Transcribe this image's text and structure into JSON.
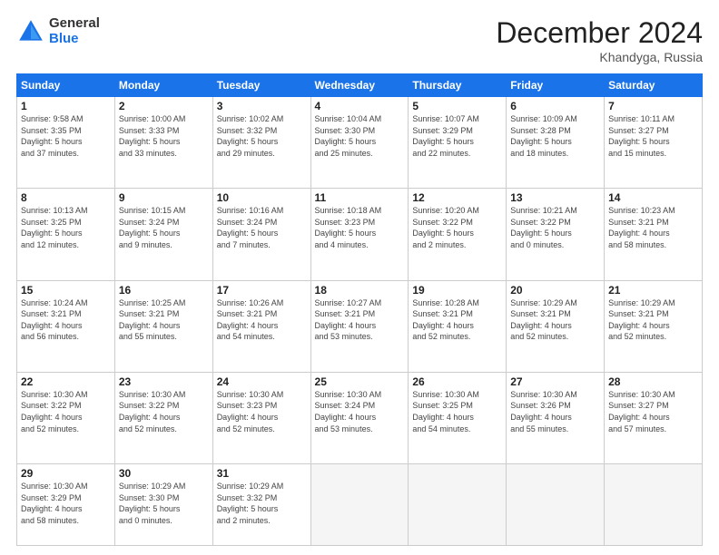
{
  "logo": {
    "general": "General",
    "blue": "Blue"
  },
  "header": {
    "month": "December 2024",
    "location": "Khandyga, Russia"
  },
  "weekdays": [
    "Sunday",
    "Monday",
    "Tuesday",
    "Wednesday",
    "Thursday",
    "Friday",
    "Saturday"
  ],
  "weeks": [
    [
      {
        "day": "1",
        "info": "Sunrise: 9:58 AM\nSunset: 3:35 PM\nDaylight: 5 hours\nand 37 minutes."
      },
      {
        "day": "2",
        "info": "Sunrise: 10:00 AM\nSunset: 3:33 PM\nDaylight: 5 hours\nand 33 minutes."
      },
      {
        "day": "3",
        "info": "Sunrise: 10:02 AM\nSunset: 3:32 PM\nDaylight: 5 hours\nand 29 minutes."
      },
      {
        "day": "4",
        "info": "Sunrise: 10:04 AM\nSunset: 3:30 PM\nDaylight: 5 hours\nand 25 minutes."
      },
      {
        "day": "5",
        "info": "Sunrise: 10:07 AM\nSunset: 3:29 PM\nDaylight: 5 hours\nand 22 minutes."
      },
      {
        "day": "6",
        "info": "Sunrise: 10:09 AM\nSunset: 3:28 PM\nDaylight: 5 hours\nand 18 minutes."
      },
      {
        "day": "7",
        "info": "Sunrise: 10:11 AM\nSunset: 3:27 PM\nDaylight: 5 hours\nand 15 minutes."
      }
    ],
    [
      {
        "day": "8",
        "info": "Sunrise: 10:13 AM\nSunset: 3:25 PM\nDaylight: 5 hours\nand 12 minutes."
      },
      {
        "day": "9",
        "info": "Sunrise: 10:15 AM\nSunset: 3:24 PM\nDaylight: 5 hours\nand 9 minutes."
      },
      {
        "day": "10",
        "info": "Sunrise: 10:16 AM\nSunset: 3:24 PM\nDaylight: 5 hours\nand 7 minutes."
      },
      {
        "day": "11",
        "info": "Sunrise: 10:18 AM\nSunset: 3:23 PM\nDaylight: 5 hours\nand 4 minutes."
      },
      {
        "day": "12",
        "info": "Sunrise: 10:20 AM\nSunset: 3:22 PM\nDaylight: 5 hours\nand 2 minutes."
      },
      {
        "day": "13",
        "info": "Sunrise: 10:21 AM\nSunset: 3:22 PM\nDaylight: 5 hours\nand 0 minutes."
      },
      {
        "day": "14",
        "info": "Sunrise: 10:23 AM\nSunset: 3:21 PM\nDaylight: 4 hours\nand 58 minutes."
      }
    ],
    [
      {
        "day": "15",
        "info": "Sunrise: 10:24 AM\nSunset: 3:21 PM\nDaylight: 4 hours\nand 56 minutes."
      },
      {
        "day": "16",
        "info": "Sunrise: 10:25 AM\nSunset: 3:21 PM\nDaylight: 4 hours\nand 55 minutes."
      },
      {
        "day": "17",
        "info": "Sunrise: 10:26 AM\nSunset: 3:21 PM\nDaylight: 4 hours\nand 54 minutes."
      },
      {
        "day": "18",
        "info": "Sunrise: 10:27 AM\nSunset: 3:21 PM\nDaylight: 4 hours\nand 53 minutes."
      },
      {
        "day": "19",
        "info": "Sunrise: 10:28 AM\nSunset: 3:21 PM\nDaylight: 4 hours\nand 52 minutes."
      },
      {
        "day": "20",
        "info": "Sunrise: 10:29 AM\nSunset: 3:21 PM\nDaylight: 4 hours\nand 52 minutes."
      },
      {
        "day": "21",
        "info": "Sunrise: 10:29 AM\nSunset: 3:21 PM\nDaylight: 4 hours\nand 52 minutes."
      }
    ],
    [
      {
        "day": "22",
        "info": "Sunrise: 10:30 AM\nSunset: 3:22 PM\nDaylight: 4 hours\nand 52 minutes."
      },
      {
        "day": "23",
        "info": "Sunrise: 10:30 AM\nSunset: 3:22 PM\nDaylight: 4 hours\nand 52 minutes."
      },
      {
        "day": "24",
        "info": "Sunrise: 10:30 AM\nSunset: 3:23 PM\nDaylight: 4 hours\nand 52 minutes."
      },
      {
        "day": "25",
        "info": "Sunrise: 10:30 AM\nSunset: 3:24 PM\nDaylight: 4 hours\nand 53 minutes."
      },
      {
        "day": "26",
        "info": "Sunrise: 10:30 AM\nSunset: 3:25 PM\nDaylight: 4 hours\nand 54 minutes."
      },
      {
        "day": "27",
        "info": "Sunrise: 10:30 AM\nSunset: 3:26 PM\nDaylight: 4 hours\nand 55 minutes."
      },
      {
        "day": "28",
        "info": "Sunrise: 10:30 AM\nSunset: 3:27 PM\nDaylight: 4 hours\nand 57 minutes."
      }
    ],
    [
      {
        "day": "29",
        "info": "Sunrise: 10:30 AM\nSunset: 3:29 PM\nDaylight: 4 hours\nand 58 minutes."
      },
      {
        "day": "30",
        "info": "Sunrise: 10:29 AM\nSunset: 3:30 PM\nDaylight: 5 hours\nand 0 minutes."
      },
      {
        "day": "31",
        "info": "Sunrise: 10:29 AM\nSunset: 3:32 PM\nDaylight: 5 hours\nand 2 minutes."
      },
      null,
      null,
      null,
      null
    ]
  ]
}
